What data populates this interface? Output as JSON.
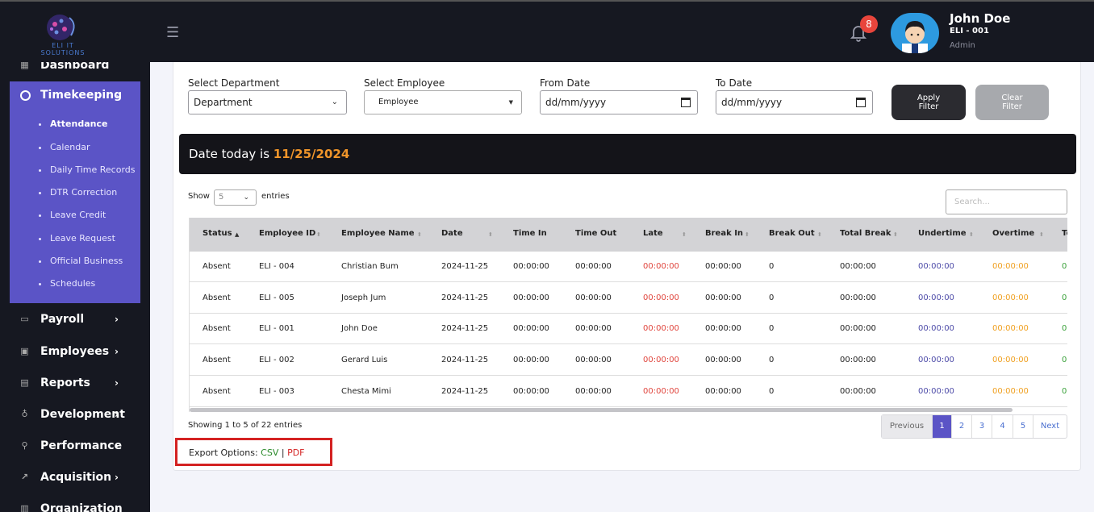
{
  "brand": {
    "logo_text": "ELI IT SOLUTIONS"
  },
  "header": {
    "notification_count": "8",
    "user_name": "John Doe",
    "user_id": "ELI - 001",
    "user_role": "Admin"
  },
  "sidebar": {
    "items": [
      {
        "label": "Dashboard",
        "icon": "grid-icon"
      },
      {
        "label": "Timekeeping",
        "icon": "clock-icon"
      },
      {
        "label": "Payroll",
        "icon": "wallet-icon"
      },
      {
        "label": "Employees",
        "icon": "id-card-icon"
      },
      {
        "label": "Reports",
        "icon": "document-icon"
      },
      {
        "label": "Development",
        "icon": "lightbulb-icon"
      },
      {
        "label": "Performance",
        "icon": "running-icon"
      },
      {
        "label": "Acquisition",
        "icon": "chart-icon"
      },
      {
        "label": "Organization",
        "icon": "building-icon"
      }
    ],
    "timekeeping_sub": [
      "Attendance",
      "Calendar",
      "Daily Time Records",
      "DTR Correction",
      "Leave Credit",
      "Leave Request",
      "Official Business",
      "Schedules"
    ]
  },
  "filters": {
    "department_label": "Select Department",
    "department_value": "Department",
    "employee_label": "Select Employee",
    "employee_value": "Employee",
    "from_label": "From Date",
    "from_value": "dd/mm/yyyy",
    "to_label": "To Date",
    "to_value": "dd/mm/yyyy",
    "apply_line1": "Apply",
    "apply_line2": "Filter",
    "clear_line1": "Clear",
    "clear_line2": "Filter"
  },
  "banner": {
    "prefix": "Date today is ",
    "date": "11/25/2024"
  },
  "table_controls": {
    "show": "Show",
    "page_size": "5",
    "entries": "entries",
    "search_placeholder": "Search..."
  },
  "table": {
    "columns": [
      "Status",
      "Employee ID",
      "Employee Name",
      "Date",
      "Time In",
      "Time Out",
      "Late",
      "Break In",
      "Break Out",
      "Total Break",
      "Undertime",
      "Overtime",
      "To"
    ],
    "rows": [
      [
        "Absent",
        "ELI - 004",
        "Christian Bum",
        "2024-11-25",
        "00:00:00",
        "00:00:00",
        "00:00:00",
        "00:00:00",
        "0",
        "00:00:00",
        "00:00:00",
        "00:00:00",
        "0"
      ],
      [
        "Absent",
        "ELI - 005",
        "Joseph Jum",
        "2024-11-25",
        "00:00:00",
        "00:00:00",
        "00:00:00",
        "00:00:00",
        "0",
        "00:00:00",
        "00:00:00",
        "00:00:00",
        "0"
      ],
      [
        "Absent",
        "ELI - 001",
        "John Doe",
        "2024-11-25",
        "00:00:00",
        "00:00:00",
        "00:00:00",
        "00:00:00",
        "0",
        "00:00:00",
        "00:00:00",
        "00:00:00",
        "0"
      ],
      [
        "Absent",
        "ELI - 002",
        "Gerard Luis",
        "2024-11-25",
        "00:00:00",
        "00:00:00",
        "00:00:00",
        "00:00:00",
        "0",
        "00:00:00",
        "00:00:00",
        "00:00:00",
        "0"
      ],
      [
        "Absent",
        "ELI - 003",
        "Chesta Mimi",
        "2024-11-25",
        "00:00:00",
        "00:00:00",
        "00:00:00",
        "00:00:00",
        "0",
        "00:00:00",
        "00:00:00",
        "00:00:00",
        "0"
      ]
    ]
  },
  "footer": {
    "showing": "Showing 1 to 5 of 22 entries"
  },
  "pagination": {
    "previous": "Previous",
    "pages": [
      "1",
      "2",
      "3",
      "4",
      "5"
    ],
    "next": "Next",
    "active": "1"
  },
  "export": {
    "label": "Export Options:",
    "csv": "CSV",
    "separator": "|",
    "pdf": "PDF"
  },
  "colors": {
    "sidebar_active": "#5b54c6",
    "late": "#e0453d",
    "undertime": "#4d4ba8",
    "overtime": "#f0a020",
    "total": "#3aa13a",
    "banner_date": "#f0952a"
  }
}
